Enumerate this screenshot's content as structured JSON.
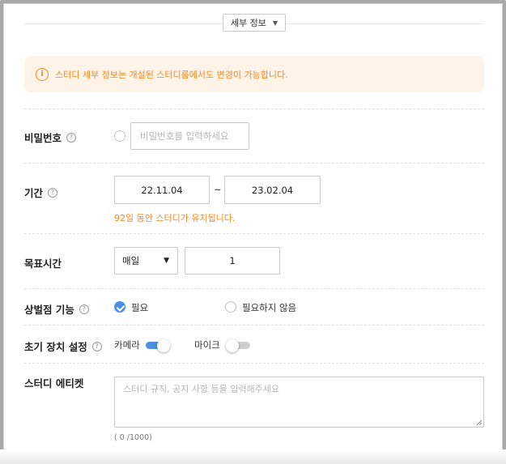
{
  "section_toggle": {
    "label": "세부 정보",
    "icon": "caret-down-icon"
  },
  "notice": {
    "icon": "info-icon",
    "icon_glyph": "i",
    "text": "스터디 세부 정보는 개설된 스터디룸에서도 변경이 가능합니다."
  },
  "password": {
    "label": "비밀번호",
    "help": "?",
    "placeholder": "비밀번호를 입력하세요",
    "enabled": false
  },
  "period": {
    "label": "기간",
    "help": "?",
    "start": "22.11.04",
    "separator": "~",
    "end": "23.02.04",
    "note": "92일 동안 스터디가 유지됩니다."
  },
  "goal_time": {
    "label": "목표시간",
    "frequency": "매일",
    "amount": "1"
  },
  "reward_penalty": {
    "label": "상벌점 기능",
    "help": "?",
    "options": [
      "필요",
      "필요하지 않음"
    ],
    "selected": "필요"
  },
  "device_setup": {
    "label": "초기 장치 설정",
    "help": "?",
    "camera_label": "카메라",
    "camera_on": true,
    "mic_label": "마이크",
    "mic_on": false
  },
  "etiquette": {
    "label": "스터디 에티켓",
    "placeholder": "스터디 규칙, 공지 사항 등을 입력해주세요",
    "counter": "( 0 /1000)"
  },
  "colors": {
    "accent": "#4a90e2",
    "warning": "#f08a24",
    "notice_bg": "#fef3e7"
  }
}
